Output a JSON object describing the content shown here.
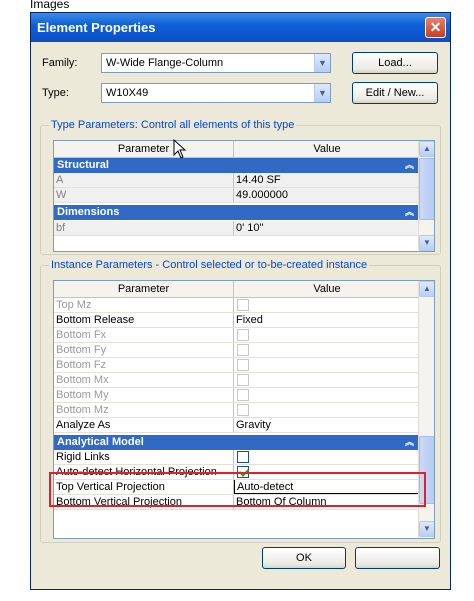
{
  "page_caption": "Images",
  "dialog": {
    "title": "Element Properties",
    "close_glyph": "✕"
  },
  "family": {
    "label": "Family:",
    "value": "W-Wide Flange-Column"
  },
  "type": {
    "label": "Type:",
    "value": "W10X49"
  },
  "buttons": {
    "load": "Load...",
    "edit_new": "Edit / New...",
    "ok": "OK"
  },
  "type_parameters": {
    "title": "Type Parameters: Control all elements of this type",
    "columns": [
      "Parameter",
      "Value"
    ],
    "sections": [
      {
        "name": "Structural",
        "rows": [
          {
            "param": "A",
            "value": "14.40 SF"
          },
          {
            "param": "W",
            "value": "49.000000"
          }
        ]
      },
      {
        "name": "Dimensions",
        "rows": [
          {
            "param": "bf",
            "value": "0'  10\""
          }
        ]
      }
    ]
  },
  "instance_parameters": {
    "title": "Instance Parameters - Control selected or to-be-created instance",
    "columns": [
      "Parameter",
      "Value"
    ],
    "rows": [
      {
        "param": "Top Mz",
        "value": "",
        "kind": "checkbox",
        "enabled": false,
        "checked": false
      },
      {
        "param": "Bottom Release",
        "value": "Fixed",
        "kind": "text",
        "enabled": true
      },
      {
        "param": "Bottom Fx",
        "value": "",
        "kind": "checkbox",
        "enabled": false,
        "checked": false
      },
      {
        "param": "Bottom Fy",
        "value": "",
        "kind": "checkbox",
        "enabled": false,
        "checked": false
      },
      {
        "param": "Bottom Fz",
        "value": "",
        "kind": "checkbox",
        "enabled": false,
        "checked": false
      },
      {
        "param": "Bottom Mx",
        "value": "",
        "kind": "checkbox",
        "enabled": false,
        "checked": false
      },
      {
        "param": "Bottom My",
        "value": "",
        "kind": "checkbox",
        "enabled": false,
        "checked": false
      },
      {
        "param": "Bottom Mz",
        "value": "",
        "kind": "checkbox",
        "enabled": false,
        "checked": false
      },
      {
        "param": "Analyze As",
        "value": "Gravity",
        "kind": "text",
        "enabled": true
      }
    ],
    "section": "Analytical Model",
    "analytical_rows": [
      {
        "param": "Rigid Links",
        "value": "",
        "kind": "checkbox",
        "enabled": true,
        "checked": false
      },
      {
        "param": "Auto-detect Horizontal Projection",
        "value": "",
        "kind": "checkbox",
        "enabled": true,
        "checked": true
      },
      {
        "param": "Top Vertical Projection",
        "value": "Auto-detect",
        "kind": "edit",
        "enabled": true
      },
      {
        "param": "Bottom Vertical Projection",
        "value": "Bottom Of Column",
        "kind": "text",
        "enabled": true
      }
    ]
  },
  "colors": {
    "highlight": "#e0202a",
    "section": "#316ac5",
    "titlebar": "#0a4fc7"
  }
}
